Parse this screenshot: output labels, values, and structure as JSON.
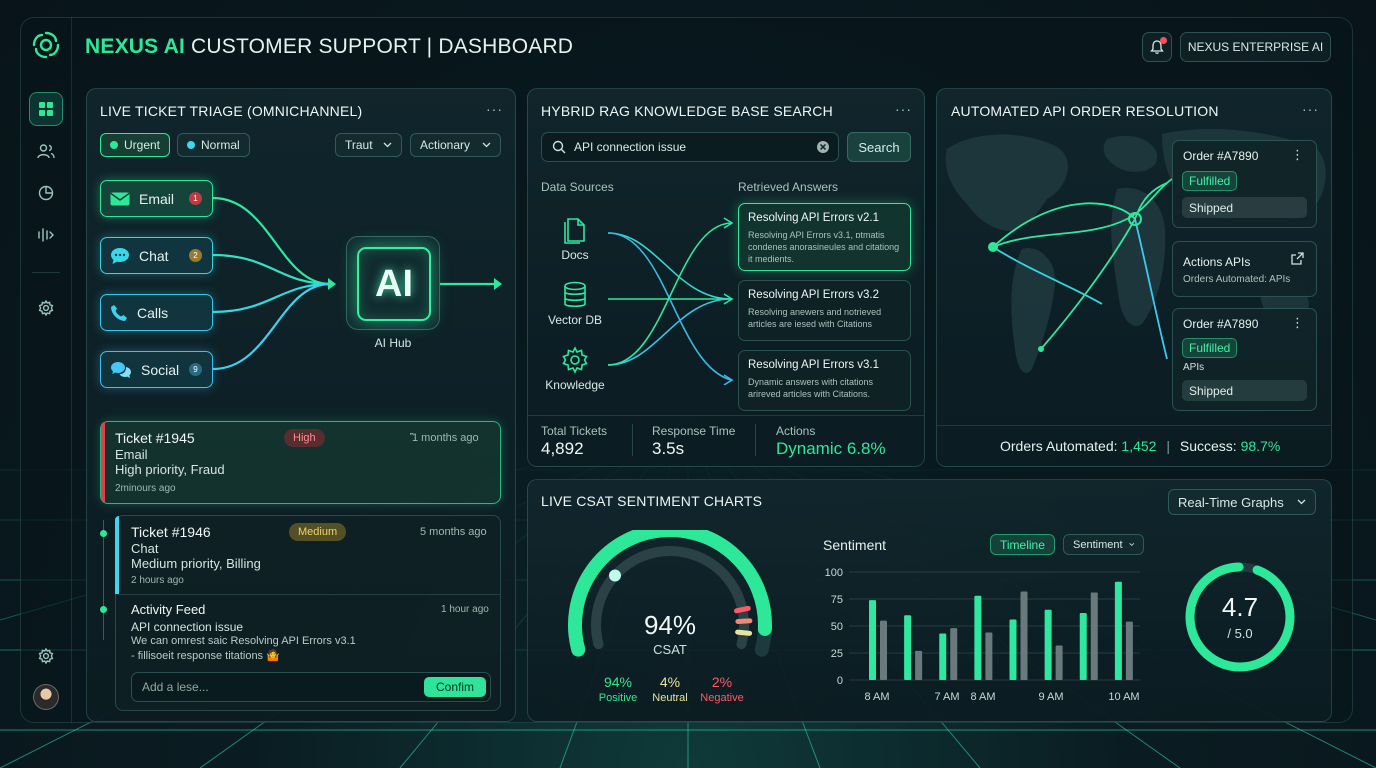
{
  "header": {
    "brand": "NEXUS AI",
    "title_rest": " CUSTOMER SUPPORT | DASHBOARD",
    "enterprise_label": "NEXUS ENTERPRISE AI"
  },
  "sidebar": {
    "items": [
      {
        "name": "dashboard-icon",
        "active": true
      },
      {
        "name": "users-icon"
      },
      {
        "name": "pie-chart-icon"
      },
      {
        "name": "audio-icon"
      },
      {
        "name": "settings-icon"
      }
    ]
  },
  "triage": {
    "title": "LIVE TICKET TRIAGE (OMNICHANNEL)",
    "menu": "···",
    "filters": {
      "urgent": "Urgent",
      "normal": "Normal"
    },
    "selects": [
      "Traut",
      "Actionary"
    ],
    "channels": [
      {
        "label": "Email",
        "badge": "1"
      },
      {
        "label": "Chat",
        "badge": "2"
      },
      {
        "label": "Calls"
      },
      {
        "label": "Social",
        "badge": "9"
      }
    ],
    "hub_text": "AI",
    "hub_label": "AI Hub",
    "tickets": [
      {
        "id": "Ticket #1945",
        "severity": "High",
        "time": "꜠1 months ago",
        "channel": "Email",
        "desc": "High priority, Fraud",
        "age": "2minours ago"
      },
      {
        "id": "Ticket #1946",
        "severity": "Medium",
        "time": "5 months ago",
        "channel": "Chat",
        "desc": "Medium priority, Billing",
        "age": "2 hours ago"
      }
    ],
    "activity": {
      "title": "Activity Feed",
      "time": "1 hour ago",
      "subject": "API connection issue",
      "line1": "We can omrest saic Resolving API Errors v3.1",
      "line2": "- fillisoeit response titations 🤷",
      "input_placeholder": "Add a lese...",
      "confirm": "Confim"
    }
  },
  "rag": {
    "title": "HYBRID RAG KNOWLEDGE BASE SEARCH",
    "menu": "···",
    "search_value": "API connection issue",
    "search_button": "Search",
    "sources_label": "Data Sources",
    "answers_label": "Retrieved Answers",
    "sources": [
      "Docs",
      "Vector DB",
      "Knowledge"
    ],
    "answers": [
      {
        "title": "Resolving API Errors v2.1",
        "body": "Resolving API Errors v3.1, ɒtmatis condenes anorasineules and citationg it medients."
      },
      {
        "title": "Resolving API Errors v3.2",
        "body": "Resolving anewers and notrieved articles are iesed with Citations"
      },
      {
        "title": "Resolving API Errors v3.1",
        "body": "Dynamic answers with citations arireved articles with Citations."
      }
    ],
    "stats": [
      {
        "label": "Total Tickets",
        "value": "4,892"
      },
      {
        "label": "Response Time",
        "value": "3.5s"
      },
      {
        "label": "Actions",
        "value": "Dynamic 6.8%"
      }
    ]
  },
  "orders": {
    "title": "AUTOMATED API ORDER RESOLUTION",
    "menu": "···",
    "cards": [
      {
        "order": "Order #A7890",
        "status": "Fulfilled",
        "ship": "Shipped"
      },
      {
        "title": "Actions APIs",
        "sub": "Orders Automated: APIs"
      },
      {
        "order": "Order #A7890",
        "status": "Fulfilled",
        "extra": "APIs",
        "ship": "Shipped"
      }
    ],
    "footer_label1": "Orders Automated:",
    "footer_value1": "1,452",
    "footer_label2": "Success:",
    "footer_value2": "98.7%"
  },
  "csat": {
    "title": "LIVE CSAT SENTIMENT CHARTS",
    "dropdown": "Real-Time Graphs",
    "gauge_value": "94%",
    "gauge_label": "CSAT",
    "gauge_fraction": 0.94,
    "legend": [
      {
        "pct": "94%",
        "label": "Positive",
        "color": "#36e88f"
      },
      {
        "pct": "4%",
        "label": "Neutral",
        "color": "#e8e4a0"
      },
      {
        "pct": "2%",
        "label": "Negative",
        "color": "#ff5a64"
      }
    ],
    "sentiment_title": "Sentiment",
    "tab_timeline": "Timeline",
    "tab_sentiment": "Sentiment",
    "rating_value": "4.7",
    "rating_max": "/ 5.0",
    "rating_fraction": 0.94
  },
  "chart_data": {
    "type": "bar",
    "title": "Sentiment",
    "ylim": [
      0,
      100
    ],
    "yticks": [
      0,
      25,
      50,
      75,
      100
    ],
    "xticks": [
      "8 AM",
      "7 AM",
      "8 AM",
      "9 AM",
      "10 AM"
    ],
    "grid": true,
    "series": [
      {
        "values": [
          74,
          60,
          43,
          78,
          56,
          65,
          62,
          91
        ],
        "color": "#2ee8a0"
      },
      {
        "values": [
          55,
          27,
          48,
          44,
          82,
          32,
          81,
          54
        ],
        "color": "#6a7a7c"
      }
    ]
  },
  "colors": {
    "accent": "#2ee89a",
    "cyan": "#3fd6f0",
    "danger": "#ff4d5e",
    "warning": "#d8b04a"
  }
}
